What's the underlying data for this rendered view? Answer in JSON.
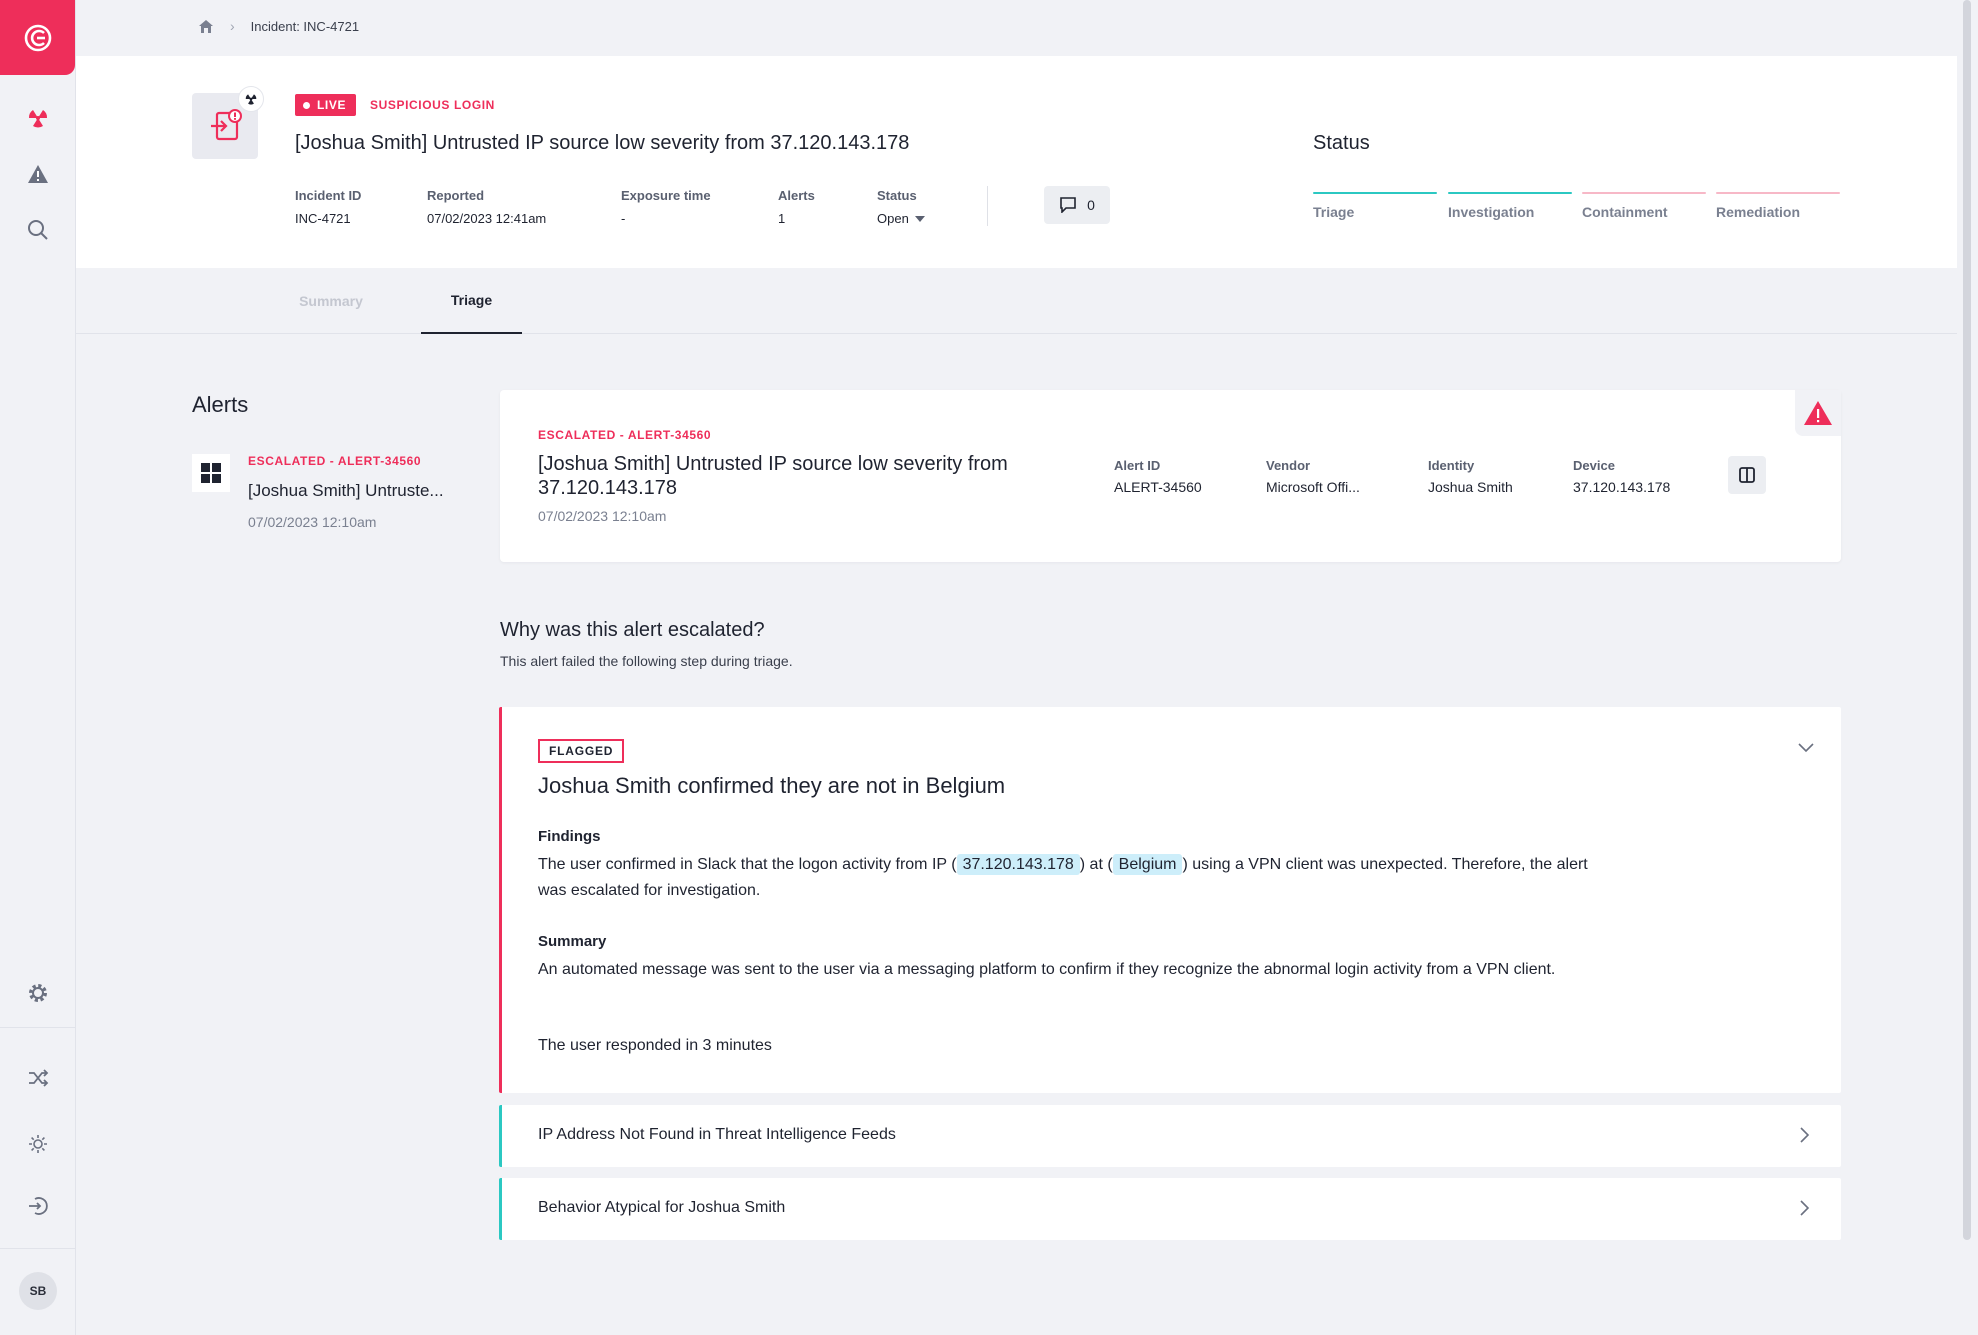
{
  "sidebar": {
    "logo": "app-logo",
    "user_initials": "SB"
  },
  "breadcrumb": {
    "current": "Incident: INC-4721"
  },
  "incident": {
    "live_label": "LIVE",
    "type": "SUSPICIOUS LOGIN",
    "title": "[Joshua Smith] Untrusted IP source low severity from 37.120.143.178",
    "meta": [
      {
        "label": "Incident ID",
        "value": "INC-4721"
      },
      {
        "label": "Reported",
        "value": "07/02/2023 12:41am"
      },
      {
        "label": "Exposure time",
        "value": "-"
      },
      {
        "label": "Alerts",
        "value": "1"
      },
      {
        "label": "Status",
        "value": "Open"
      }
    ],
    "comment_count": "0"
  },
  "status_panel": {
    "title": "Status",
    "stages": [
      {
        "label": "Triage",
        "state": "done"
      },
      {
        "label": "Investigation",
        "state": "done"
      },
      {
        "label": "Containment",
        "state": "pending"
      },
      {
        "label": "Remediation",
        "state": "pending"
      }
    ]
  },
  "tabs": [
    {
      "label": "Summary",
      "active": false
    },
    {
      "label": "Triage",
      "active": true
    }
  ],
  "alerts_list": {
    "heading": "Alerts",
    "items": [
      {
        "tag": "ESCALATED - ALERT-34560",
        "title": "[Joshua Smith] Untruste...",
        "date": "07/02/2023 12:10am"
      }
    ]
  },
  "alert_card": {
    "tag": "ESCALATED - ALERT-34560",
    "title": "[Joshua Smith] Untrusted IP source low severity from 37.120.143.178",
    "date": "07/02/2023 12:10am",
    "fields": [
      {
        "label": "Alert ID",
        "value": "ALERT-34560"
      },
      {
        "label": "Vendor",
        "value": "Microsoft Offi..."
      },
      {
        "label": "Identity",
        "value": "Joshua Smith"
      },
      {
        "label": "Device",
        "value": "37.120.143.178"
      }
    ]
  },
  "escalation": {
    "heading": "Why was this alert escalated?",
    "subheading": "This alert failed the following step during triage.",
    "flagged": {
      "badge": "FLAGGED",
      "title": "Joshua Smith confirmed they are not in Belgium",
      "findings_label": "Findings",
      "findings_p1": "The user confirmed in Slack that the logon activity from IP (",
      "findings_ip": "37.120.143.178",
      "findings_p2": ") at (",
      "findings_country": "Belgium",
      "findings_p3": ") using a VPN client was unexpected. Therefore, the alert was escalated for investigation.",
      "summary_label": "Summary",
      "summary_text": "An automated message was sent to the user via a messaging platform to confirm if they recognize the abnormal login activity from a VPN client.",
      "response_text": "The user responded in 3 minutes"
    },
    "steps": [
      {
        "title": "IP Address Not Found in Threat Intelligence Feeds"
      },
      {
        "title": "Behavior Atypical for Joshua Smith"
      }
    ]
  },
  "colors": {
    "accent": "#ee2e5a",
    "teal": "#2bc8c2",
    "highlight": "#cdeefa"
  }
}
